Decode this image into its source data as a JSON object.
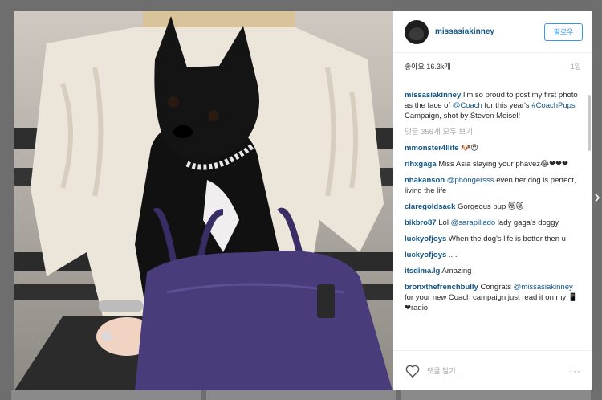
{
  "post": {
    "username": "missasiakinney",
    "follow_label": "팔로우",
    "likes_text": "좋아요 16.3k개",
    "time_text": "1일",
    "caption": {
      "user": "missasiakinney",
      "t1": " I'm so proud to post my first photo as the face of ",
      "mention": "@Coach",
      "t2": " for this year's ",
      "hashtag": "#CoachPups",
      "t3": " Campaign, shot by Steven Meisel!"
    },
    "view_all": "댓글 356개 모두 보기",
    "comments": [
      {
        "user": "mmonster4llife",
        "pre": " 🐶😍",
        "link": "",
        "post": ""
      },
      {
        "user": "rihxgaga",
        "pre": " Miss Asia slaying your phavez😂❤❤❤",
        "link": "",
        "post": ""
      },
      {
        "user": "nhakanson",
        "pre": " ",
        "link": "@phongersss",
        "post": " even her dog is perfect, living the life"
      },
      {
        "user": "claregoldsack",
        "pre": " Gorgeous pup 😻😻",
        "link": "",
        "post": ""
      },
      {
        "user": "bikbro87",
        "pre": " Lol ",
        "link": "@sarapillado",
        "post": " lady gaga's doggy"
      },
      {
        "user": "luckyofjoys",
        "pre": " When the dog's life is better then u",
        "link": "",
        "post": ""
      },
      {
        "user": "luckyofjoys",
        "pre": " ....",
        "link": "",
        "post": ""
      },
      {
        "user": "itsdima.lg",
        "pre": " Amazing",
        "link": "",
        "post": ""
      },
      {
        "user": "bronxthefrenchbully",
        "pre": " Congrats ",
        "link": "@missasiakinney",
        "post": " for your new Coach campaign just read it on my 📱❤radio"
      }
    ],
    "add_comment_placeholder": "댓글 달기...",
    "more_options": "···",
    "next_arrow": "›"
  },
  "icons": {
    "heart": "heart-icon",
    "more": "more-options-icon",
    "next": "chevron-right-icon"
  },
  "colors": {
    "username": "#125688",
    "follow": "#3897f0",
    "bag": "#4a3b7a"
  }
}
